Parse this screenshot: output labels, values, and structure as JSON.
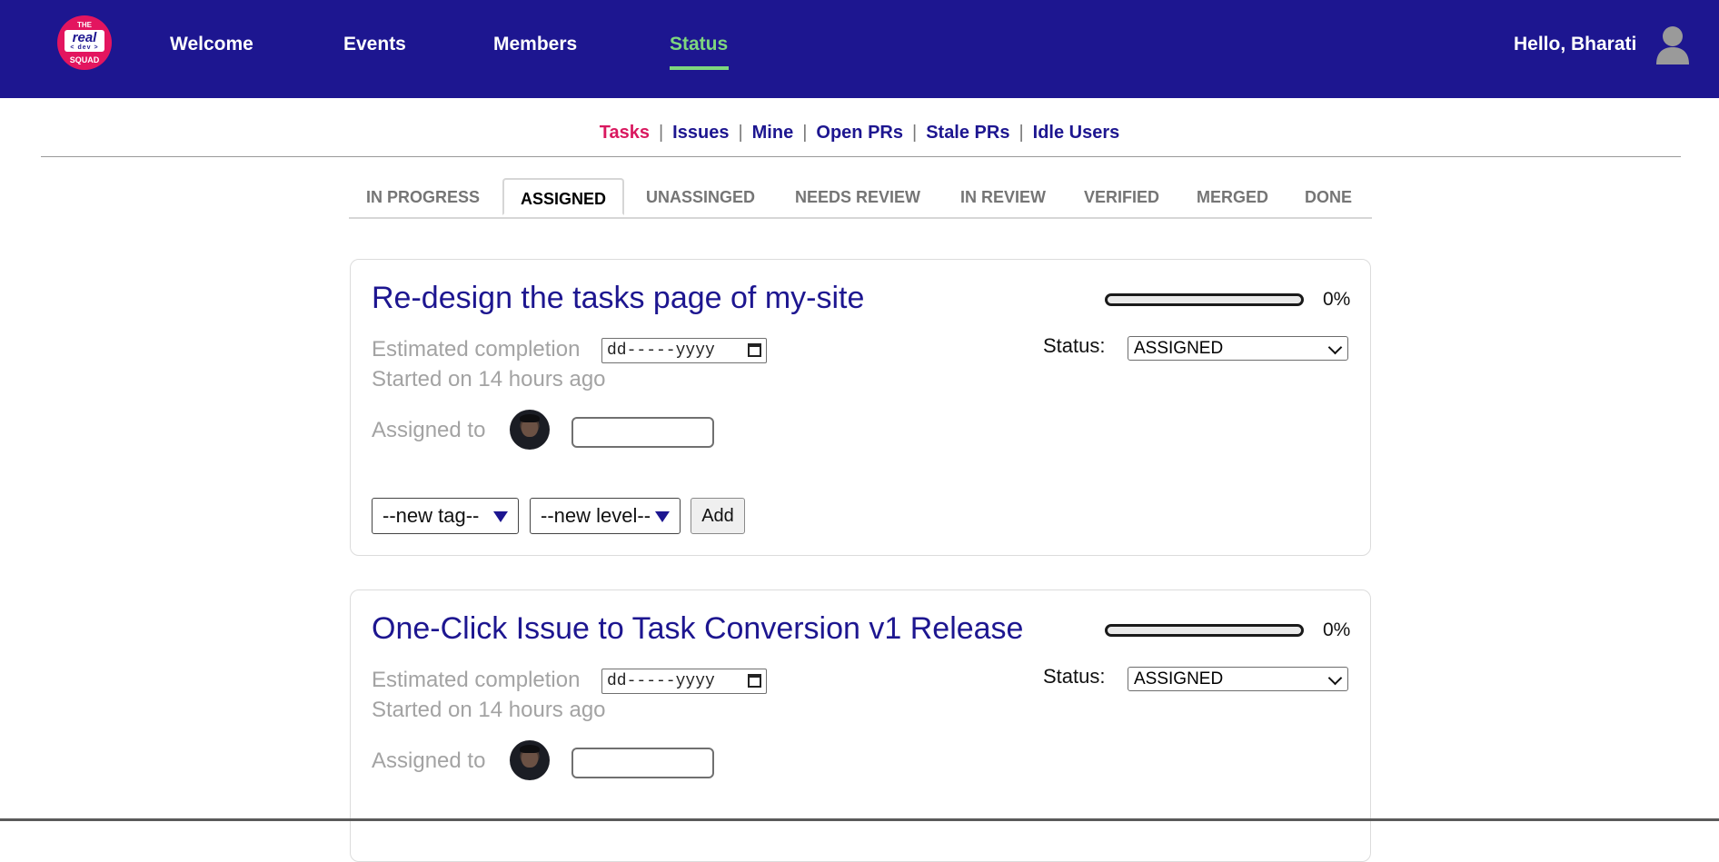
{
  "logo": {
    "line1": "THE",
    "line2": "real",
    "line3": "< dev >",
    "line4": "SQUAD"
  },
  "nav": {
    "items": [
      {
        "label": "Welcome"
      },
      {
        "label": "Events"
      },
      {
        "label": "Members"
      },
      {
        "label": "Status",
        "active": true
      }
    ],
    "greeting": "Hello, Bharati",
    "user_icon": "user-avatar-icon"
  },
  "subnav": {
    "items": [
      {
        "label": "Tasks",
        "active": true
      },
      {
        "label": "Issues"
      },
      {
        "label": "Mine"
      },
      {
        "label": "Open PRs"
      },
      {
        "label": "Stale PRs"
      },
      {
        "label": "Idle Users"
      }
    ],
    "separator": "|"
  },
  "tabs": [
    {
      "label": "IN PROGRESS"
    },
    {
      "label": "ASSIGNED",
      "active": true
    },
    {
      "label": "UNASSINGED"
    },
    {
      "label": "NEEDS REVIEW"
    },
    {
      "label": "IN REVIEW"
    },
    {
      "label": "VERIFIED"
    },
    {
      "label": "MERGED"
    },
    {
      "label": "DONE"
    }
  ],
  "tasks": [
    {
      "title": "Re-design the tasks page of my-site",
      "estimated_label": "Estimated completion",
      "date_placeholder": "dd-----yyyy",
      "started": "Started on 14 hours ago",
      "assigned_label": "Assigned to",
      "progress": 0,
      "progress_text": "0%",
      "status_label": "Status:",
      "status_value": "ASSIGNED",
      "tag_select": "--new tag--",
      "level_select": "--new level--",
      "add_label": "Add"
    },
    {
      "title": "One-Click Issue to Task Conversion v1 Release",
      "estimated_label": "Estimated completion",
      "date_placeholder": "dd-----yyyy",
      "started": "Started on 14 hours ago",
      "assigned_label": "Assigned to",
      "progress": 0,
      "progress_text": "0%",
      "status_label": "Status:",
      "status_value": "ASSIGNED"
    }
  ],
  "colors": {
    "header_bg": "#1d1690",
    "nav_active": "#7ed67e",
    "subnav_active": "#d9185f",
    "title": "#1d1690"
  }
}
